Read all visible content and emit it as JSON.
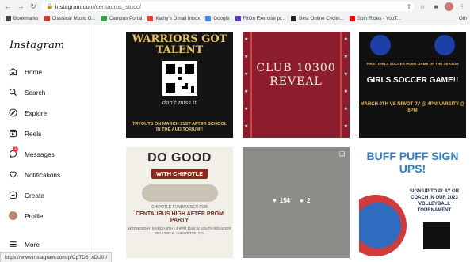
{
  "browser": {
    "url_host": "instagram.com",
    "url_path": "/centaurus_stuco/",
    "bookmarks": [
      {
        "label": "Bookmarks",
        "color": "#444444"
      },
      {
        "label": "Classical Music O...",
        "color": "#d33b2f"
      },
      {
        "label": "Campus Portal",
        "color": "#38a548"
      },
      {
        "label": "Kathy's Gmail Inbox",
        "color": "#ea4335"
      },
      {
        "label": "Google",
        "color": "#4285f4"
      },
      {
        "label": "FitOn Exercise pr...",
        "color": "#5b3bc4"
      },
      {
        "label": "Best Online Cyclin...",
        "color": "#222222"
      },
      {
        "label": "Spin Rides - YouT...",
        "color": "#ff0000"
      }
    ],
    "other_bookmarks": "Oth",
    "status_url": "https://www.instagram.com/p/CpTD6_xDU0-/"
  },
  "sidebar": {
    "logo": "Instagram",
    "items": [
      {
        "label": "Home",
        "icon": "home-icon"
      },
      {
        "label": "Search",
        "icon": "search-icon"
      },
      {
        "label": "Explore",
        "icon": "compass-icon"
      },
      {
        "label": "Reels",
        "icon": "reels-icon"
      },
      {
        "label": "Messages",
        "icon": "messenger-icon",
        "badge": "1"
      },
      {
        "label": "Notifications",
        "icon": "heart-icon"
      },
      {
        "label": "Create",
        "icon": "plus-square-icon"
      },
      {
        "label": "Profile",
        "icon": "avatar"
      },
      {
        "label": "More",
        "icon": "menu-icon"
      }
    ]
  },
  "posts": {
    "p1": {
      "title": "WARRIORS GOT TALENT",
      "script": "don't miss it",
      "note": "TRYOUTS ON MARCH 21ST AFTER SCHOOL IN THE AUDITORIUM!!"
    },
    "p2": {
      "title": "CLUB 10300 REVEAL"
    },
    "p3": {
      "subtitle": "FIRST GIRLS SOCCER HOME GAME OF THE SEASON",
      "title": "GIRLS SOCCER GAME!!",
      "details": "MARCH 9TH VS NIWOT JV @ 4PM VARSITY @ 6PM"
    },
    "p4": {
      "title": "DO GOOD",
      "brand": "WITH CHIPOTLE",
      "line1": "CHIPOTLE FUNDRAISER FOR",
      "line2": "CENTAURUS HIGH AFTER PROM PARTY",
      "line3": "WEDNESDAY, MARCH 8TH | 4-8PM 1165 W SOUTH BOULDER RD, UNIT E, LAFAYETTE, CO"
    },
    "p5": {
      "likes": "154",
      "comments": "2"
    },
    "p6": {
      "title": "BUFF PUFF SIGN UPS!",
      "info": "SIGN UP TO PLAY OR COACH IN OUR 2023 VOLLEYBALL TOURNAMENT"
    }
  }
}
